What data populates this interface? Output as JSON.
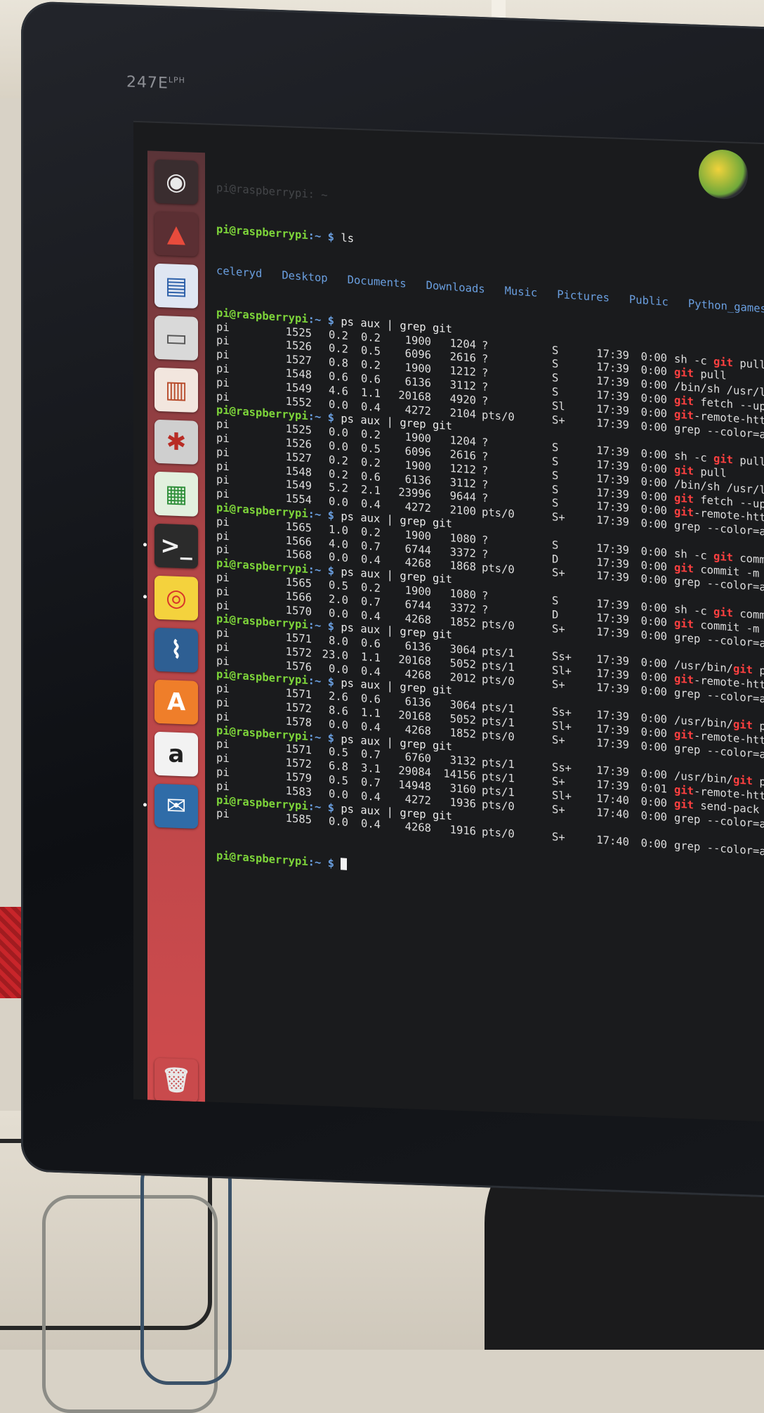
{
  "monitor": {
    "model": "247E",
    "model_sup": "LPH"
  },
  "terminal": {
    "title": "pi@raspberrypi: ~",
    "prompt_user": "pi@raspberrypi",
    "prompt_dir": ":~",
    "prompt_sign": "$",
    "ls_cmd": "ls",
    "ls_output": "celeryd   Desktop   Documents   Downloads   Music   Pictures   Public   Python_games   Scratch",
    "grep_cmd": "ps aux | grep git",
    "blocks": [
      {
        "rows": [
          [
            "pi",
            "1525",
            "0.2",
            "0.2",
            "1900",
            "1204",
            "?",
            "S",
            "17:39",
            "0:00",
            "sh -c git pull"
          ],
          [
            "pi",
            "1526",
            "0.2",
            "0.5",
            "6096",
            "2616",
            "?",
            "S",
            "17:39",
            "0:00",
            "git pull"
          ],
          [
            "pi",
            "1527",
            "0.8",
            "0.2",
            "1900",
            "1212",
            "?",
            "S",
            "17:39",
            "0:00",
            "/bin/sh /usr/lib/git-core/git-pull"
          ],
          [
            "pi",
            "1548",
            "0.6",
            "0.6",
            "6136",
            "3112",
            "?",
            "S",
            "17:39",
            "0:00",
            "git fetch --update-head-ok"
          ],
          [
            "pi",
            "1549",
            "4.6",
            "1.1",
            "20168",
            "4920",
            "?",
            "Sl",
            "17:39",
            "0:00",
            "git-remote-https origin https"
          ],
          [
            "pi",
            "1552",
            "0.0",
            "0.4",
            "4272",
            "2104",
            "pts/0",
            "S+",
            "17:39",
            "0:00",
            "grep --color=auto git"
          ]
        ]
      },
      {
        "rows": [
          [
            "pi",
            "1525",
            "0.0",
            "0.2",
            "1900",
            "1204",
            "?",
            "S",
            "17:39",
            "0:00",
            "sh -c git pull"
          ],
          [
            "pi",
            "1526",
            "0.0",
            "0.5",
            "6096",
            "2616",
            "?",
            "S",
            "17:39",
            "0:00",
            "git pull"
          ],
          [
            "pi",
            "1527",
            "0.2",
            "0.2",
            "1900",
            "1212",
            "?",
            "S",
            "17:39",
            "0:00",
            "/bin/sh /usr/lib/git-core/git-pull"
          ],
          [
            "pi",
            "1548",
            "0.2",
            "0.6",
            "6136",
            "3112",
            "?",
            "S",
            "17:39",
            "0:00",
            "git fetch --update-head-ok"
          ],
          [
            "pi",
            "1549",
            "5.2",
            "2.1",
            "23996",
            "9644",
            "?",
            "S",
            "17:39",
            "0:00",
            "git-remote-https origin https"
          ],
          [
            "pi",
            "1554",
            "0.0",
            "0.4",
            "4272",
            "2100",
            "pts/0",
            "S+",
            "17:39",
            "0:00",
            "grep --color=auto git"
          ]
        ]
      },
      {
        "rows": [
          [
            "pi",
            "1565",
            "1.0",
            "0.2",
            "1900",
            "1080",
            "?",
            "S",
            "17:39",
            "0:00",
            "sh -c git commit -m update"
          ],
          [
            "pi",
            "1566",
            "4.0",
            "0.7",
            "6744",
            "3372",
            "?",
            "D",
            "17:39",
            "0:00",
            "git commit -m update"
          ],
          [
            "pi",
            "1568",
            "0.0",
            "0.4",
            "4268",
            "1868",
            "pts/0",
            "S+",
            "17:39",
            "0:00",
            "grep --color=auto git"
          ]
        ]
      },
      {
        "rows": [
          [
            "pi",
            "1565",
            "0.5",
            "0.2",
            "1900",
            "1080",
            "?",
            "S",
            "17:39",
            "0:00",
            "sh -c git commit -m update"
          ],
          [
            "pi",
            "1566",
            "2.0",
            "0.7",
            "6744",
            "3372",
            "?",
            "D",
            "17:39",
            "0:00",
            "git commit -m update"
          ],
          [
            "pi",
            "1570",
            "0.0",
            "0.4",
            "4268",
            "1852",
            "pts/0",
            "S+",
            "17:39",
            "0:00",
            "grep --color=auto git"
          ]
        ]
      },
      {
        "rows": [
          [
            "pi",
            "1571",
            "8.0",
            "0.6",
            "6136",
            "3064",
            "pts/1",
            "Ss+",
            "17:39",
            "0:00",
            "/usr/bin/git push"
          ],
          [
            "pi",
            "1572",
            "23.0",
            "1.1",
            "20168",
            "5052",
            "pts/1",
            "Sl+",
            "17:39",
            "0:00",
            "git-remote-https origin"
          ],
          [
            "pi",
            "1576",
            "0.0",
            "0.4",
            "4268",
            "2012",
            "pts/0",
            "S+",
            "17:39",
            "0:00",
            "grep --color=auto git"
          ]
        ]
      },
      {
        "rows": [
          [
            "pi",
            "1571",
            "2.6",
            "0.6",
            "6136",
            "3064",
            "pts/1",
            "Ss+",
            "17:39",
            "0:00",
            "/usr/bin/git push"
          ],
          [
            "pi",
            "1572",
            "8.6",
            "1.1",
            "20168",
            "5052",
            "pts/1",
            "Sl+",
            "17:39",
            "0:00",
            "git-remote-https origin"
          ],
          [
            "pi",
            "1578",
            "0.0",
            "0.4",
            "4268",
            "1852",
            "pts/0",
            "S+",
            "17:39",
            "0:00",
            "grep --color=auto git"
          ]
        ]
      },
      {
        "rows": [
          [
            "pi",
            "1571",
            "0.5",
            "0.7",
            "6760",
            "3132",
            "pts/1",
            "Ss+",
            "17:39",
            "0:00",
            "/usr/bin/git push"
          ],
          [
            "pi",
            "1572",
            "6.8",
            "3.1",
            "29084",
            "14156",
            "pts/1",
            "S+",
            "17:39",
            "0:01",
            "git-remote-https origin"
          ],
          [
            "pi",
            "1579",
            "0.5",
            "0.7",
            "14948",
            "3160",
            "pts/1",
            "Sl+",
            "17:40",
            "0:00",
            "git send-pack --stateless"
          ],
          [
            "pi",
            "1583",
            "0.0",
            "0.4",
            "4272",
            "1936",
            "pts/0",
            "S+",
            "17:40",
            "0:00",
            "grep --color=auto git"
          ]
        ]
      },
      {
        "rows": [
          [
            "pi",
            "1585",
            "0.0",
            "0.4",
            "4268",
            "1916",
            "pts/0",
            "S+",
            "17:40",
            "0:00",
            "grep --color=auto git"
          ]
        ]
      }
    ]
  },
  "launcher": {
    "items": [
      {
        "name": "dash-home-icon",
        "glyph": "◉",
        "bg": "#3a2d2f",
        "fg": "#e9e9e9"
      },
      {
        "name": "system-settings-icon",
        "glyph": "▲",
        "bg": "#5b2f33",
        "fg": "#e84b3c"
      },
      {
        "name": "libreoffice-writer-icon",
        "glyph": "▤",
        "bg": "#dfe6f2",
        "fg": "#2a5ea8"
      },
      {
        "name": "file-manager-icon",
        "glyph": "▭",
        "bg": "#d9d9d9",
        "fg": "#555555"
      },
      {
        "name": "libreoffice-impress-icon",
        "glyph": "▥",
        "bg": "#f2e6de",
        "fg": "#b74b2a"
      },
      {
        "name": "system-tools-icon",
        "glyph": "✱",
        "bg": "#cfcfcf",
        "fg": "#b82c25"
      },
      {
        "name": "libreoffice-calc-icon",
        "glyph": "▦",
        "bg": "#e2f0de",
        "fg": "#2f8f3a"
      },
      {
        "name": "terminal-icon",
        "glyph": ">_",
        "bg": "#2b2b2b",
        "fg": "#f0f0f0"
      },
      {
        "name": "chrome-icon",
        "glyph": "◎",
        "bg": "#f4d23d",
        "fg": "#d8362a"
      },
      {
        "name": "system-monitor-icon",
        "glyph": "⌇",
        "bg": "#2e5f93",
        "fg": "#ffffff"
      },
      {
        "name": "software-center-icon",
        "glyph": "A",
        "bg": "#ef7e2a",
        "fg": "#ffffff"
      },
      {
        "name": "amazon-icon",
        "glyph": "a",
        "bg": "#f2f2f2",
        "fg": "#202020"
      },
      {
        "name": "thunderbird-icon",
        "glyph": "✉",
        "bg": "#2f6ca8",
        "fg": "#ffffff"
      },
      {
        "name": "trash-icon",
        "glyph": "🗑",
        "bg": "#c94a4c",
        "fg": "#e8e8e8"
      }
    ]
  },
  "colors": {
    "prompt_user": "#7ed63a",
    "prompt_dir": "#6a9fe0",
    "grep_highlight": "#ff4040",
    "launcher_bg": "#cf4b4d",
    "terminal_bg": "#1a1b1d"
  }
}
